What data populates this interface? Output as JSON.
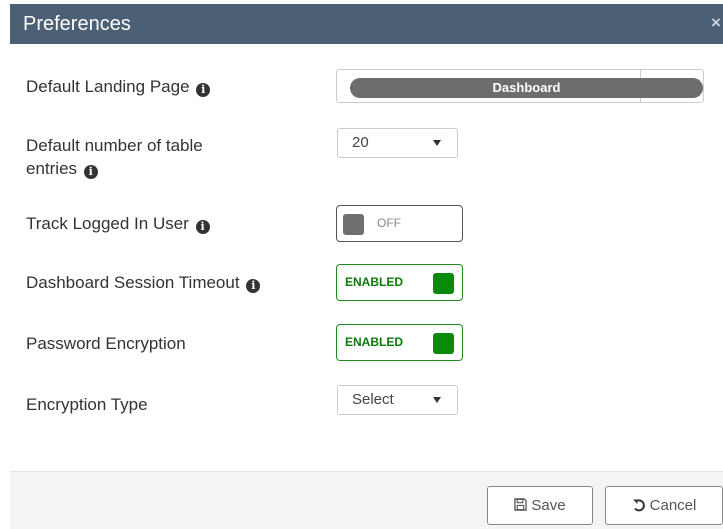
{
  "dialog": {
    "title": "Preferences",
    "close_glyph": "×"
  },
  "fields": {
    "landing_page": {
      "label": "Default Landing Page",
      "value": "Dashboard",
      "icon": "info-icon"
    },
    "table_entries": {
      "label_line1": "Default number of table",
      "label_line2": "entries",
      "value": "20",
      "icon": "info-icon"
    },
    "track_user": {
      "label": "Track Logged In User",
      "state": "OFF",
      "icon": "info-icon"
    },
    "session_timeout": {
      "label": "Dashboard Session Timeout",
      "state": "ENABLED",
      "icon": "info-icon"
    },
    "password_encryption": {
      "label": "Password Encryption",
      "state": "ENABLED"
    },
    "encryption_type": {
      "label": "Encryption Type",
      "value": "Select"
    }
  },
  "footer": {
    "save_label": "Save",
    "cancel_label": "Cancel",
    "save_icon": "floppy-disk-icon",
    "cancel_icon": "undo-icon"
  },
  "colors": {
    "titlebar": "#4b5f75",
    "enabled_green": "#0a8a0a",
    "off_gray": "#6f6f6f",
    "pill_gray": "#6d6d6d"
  }
}
